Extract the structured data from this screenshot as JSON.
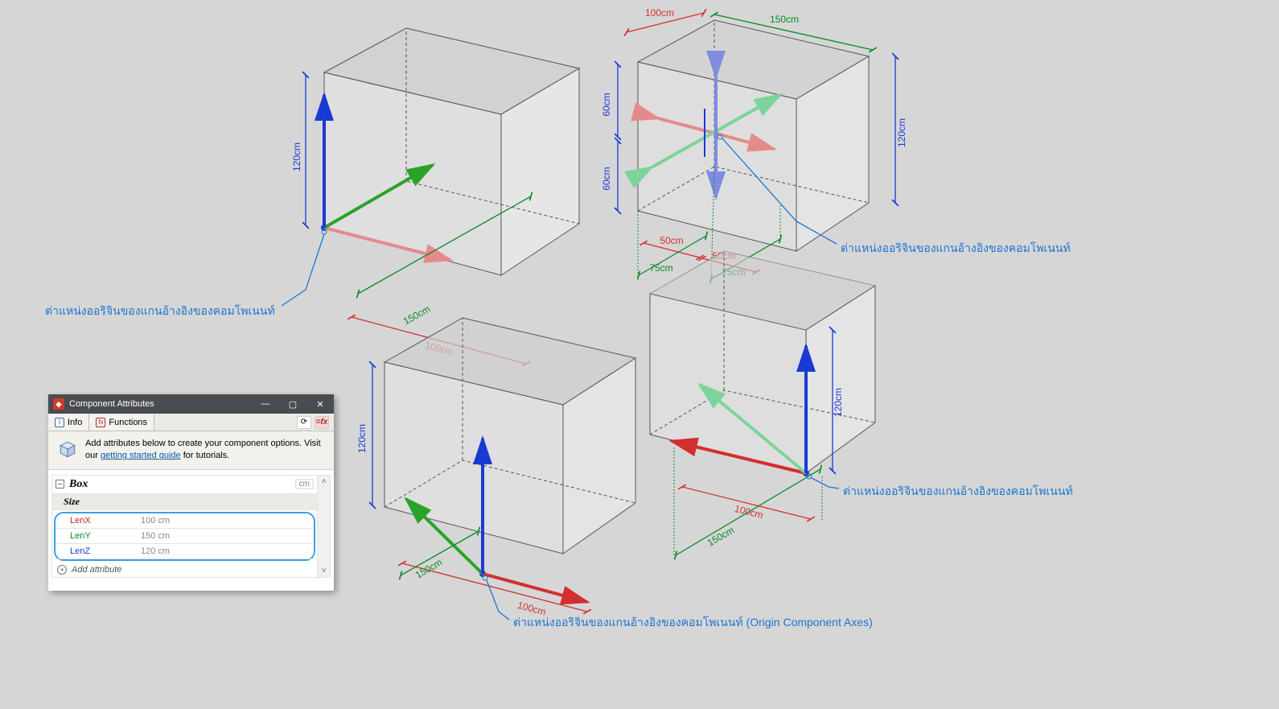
{
  "annotations": {
    "topLeft": "ต่าแหน่งออริจินของแกนอ้างอิงของคอมโพเนนท์",
    "topRight": "ต่าแหน่งออริจินของแกนอ้างอิงของคอมโพเนนท์",
    "bottomRight": "ต่าแหน่งออริจินของแกนอ้างอิงของคอมโพเนนท์",
    "bottomCenter": "ต่าแหน่งออริจินของแกนอ้างอิงของคอมโพเนนท์ (Origin Component Axes)"
  },
  "dimensions": {
    "topLeft": {
      "lenX": "100cm",
      "lenY": "150cm",
      "lenZ": "120cm"
    },
    "topRight": {
      "lenX": "100cm",
      "lenY": "150cm",
      "lenZ": "120cm",
      "halfX1": "50cm",
      "halfX2": "50cm",
      "halfY1": "75cm",
      "halfY2": "75cm",
      "halfZ1": "60cm",
      "halfZ2": "60cm"
    },
    "bottomLeft": {
      "lenX": "100cm",
      "lenY": "150cm",
      "lenZ": "120cm"
    },
    "bottomRight": {
      "lenX": "100cm",
      "lenY": "150cm",
      "lenZ": "120cm"
    }
  },
  "panel": {
    "title": "Component Attributes",
    "tabs": {
      "info": "Info",
      "functions": "Functions"
    },
    "hintPrefix": "Add attributes below to create your component options. Visit our ",
    "hintLink": "getting started guide",
    "hintSuffix": " for tutorials.",
    "component": {
      "name": "Box",
      "unit": "cm",
      "sizeHeader": "Size",
      "lenX": {
        "label": "LenX",
        "value": "100 cm"
      },
      "lenY": {
        "label": "LenY",
        "value": "150 cm"
      },
      "lenZ": {
        "label": "LenZ",
        "value": "120 cm"
      },
      "addAttr": "Add attribute"
    }
  }
}
